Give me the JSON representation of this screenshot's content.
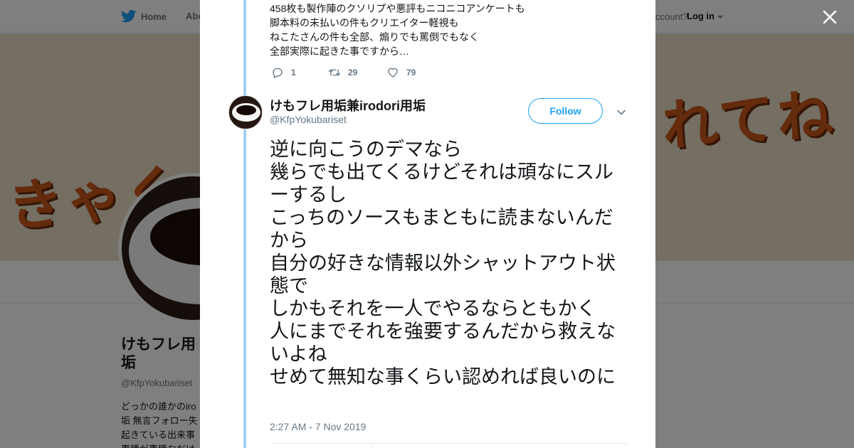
{
  "background": {
    "nav": {
      "home_label": "Home",
      "about_label": "Abo",
      "account_label": "ccount?",
      "login_label": "Log in"
    },
    "banner": {
      "left_text": "きゃく",
      "right_text": "れてね"
    },
    "profile": {
      "name": "けもフレ用垢兼irodori用垢",
      "name_visible": "けもフレ用垢",
      "handle": "@KfpYokubariset",
      "bio_visible": "どっかの誰かのiro垢 無言フォロー失起きている出来事事情が事情なだけ"
    }
  },
  "modal": {
    "previous_tweet": {
      "lines": [
        "458枚も製作陣のクソリプや悪評もニコニコアンケートも",
        "脚本料の未払いの件もクリエイター軽視も",
        "ねこたさんの件も全部、煽りでも罵倒でもなく",
        "全部実際に起きた事ですから…"
      ],
      "replies": "1",
      "retweets": "29",
      "likes": "79"
    },
    "tweet": {
      "display_name": "けもフレ用垢兼irodori用垢",
      "handle": "@KfpYokubariset",
      "follow_label": "Follow",
      "text_lines": [
        "逆に向こうのデマなら",
        "幾らでも出てくるけどそれは頑なにスルーするし",
        "こっちのソースもまともに読まないんだから",
        "自分の好きな情報以外シャットアウト状態で",
        "しかもそれを一人でやるならともかく",
        "人にまでそれを強要するんだから救えないよね",
        "せめて無知な事くらい認めれば良いのに"
      ],
      "timestamp": "2:27 AM - 7 Nov 2019"
    }
  },
  "colors": {
    "accent": "#1da1f2",
    "thread_line": "#a3d1f5",
    "muted_text": "#657786",
    "primary_text": "#14171a"
  },
  "icons": [
    "twitter-bird-icon",
    "close-icon",
    "reply-icon",
    "retweet-icon",
    "heart-icon",
    "chevron-down-icon",
    "caret-down-icon"
  ]
}
